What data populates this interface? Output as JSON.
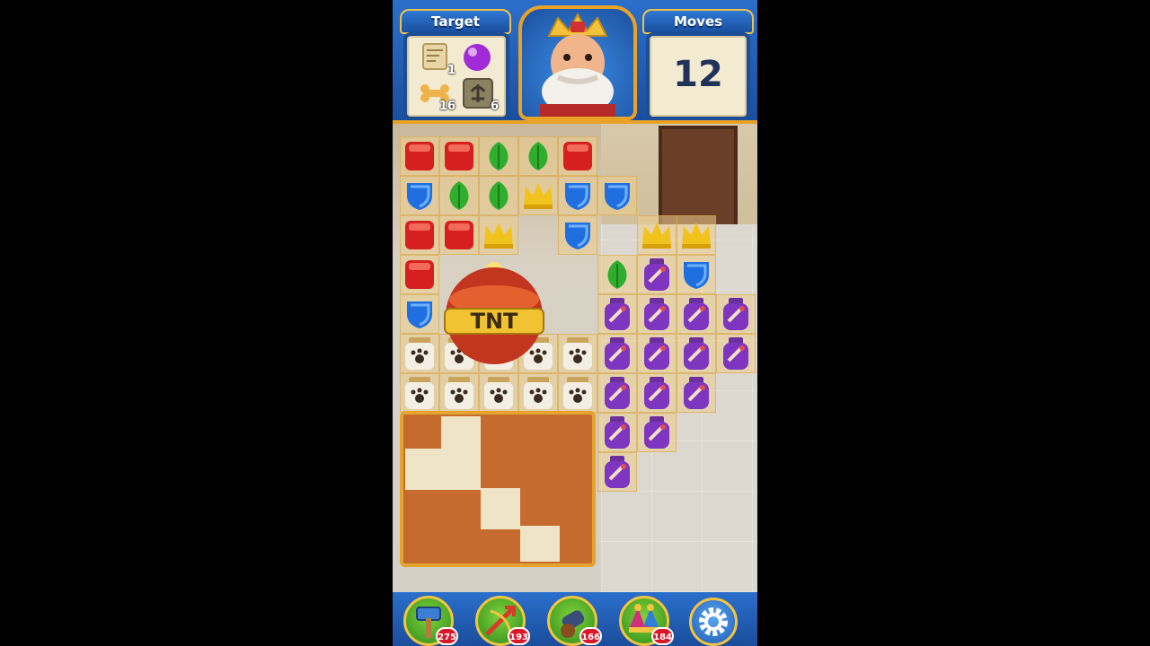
{
  "header": {
    "target_label": "Target",
    "moves_label": "Moves",
    "moves_value": "12",
    "targets": [
      {
        "name": "treasure-map",
        "count": "1"
      },
      {
        "name": "purple-orb",
        "count": ""
      },
      {
        "name": "bone",
        "count": "16"
      },
      {
        "name": "fleur-tile",
        "count": "6"
      }
    ]
  },
  "board": {
    "center_item": "TNT",
    "center_item_label": "TNT"
  },
  "boosters": [
    {
      "name": "hammer",
      "count": "275"
    },
    {
      "name": "arrow",
      "count": "193"
    },
    {
      "name": "cannon",
      "count": "166"
    },
    {
      "name": "jester-hat",
      "count": "184"
    }
  ],
  "colors": {
    "header_blue": "#1d5bb0",
    "gold": "#e7a227",
    "badge_red": "#d8182a"
  }
}
